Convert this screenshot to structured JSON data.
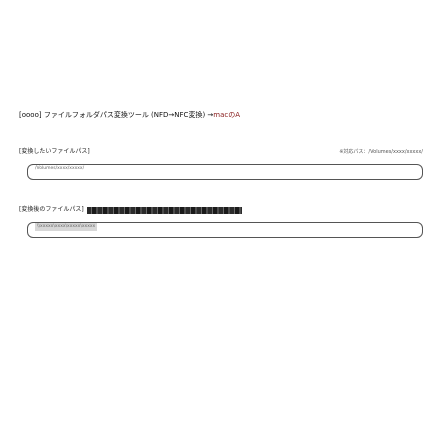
{
  "header": {
    "title_prefix": "[oooo] ファイルフォルダパス変換ツール (NFD→NFC変換) →",
    "title_accent": "macのA"
  },
  "source_path": {
    "label": "[変換したいファイルパス]",
    "note": "※対応パス：/Volumes/xxxx/xxxxx/",
    "value_prefix": "/Volumes/xxxx/xxxxx/"
  },
  "result_path": {
    "label": "[変換後のファイルパス]",
    "value_prefix": "\\\\xxxxx\\xxxx\\xxxxx\\xxxxx"
  }
}
